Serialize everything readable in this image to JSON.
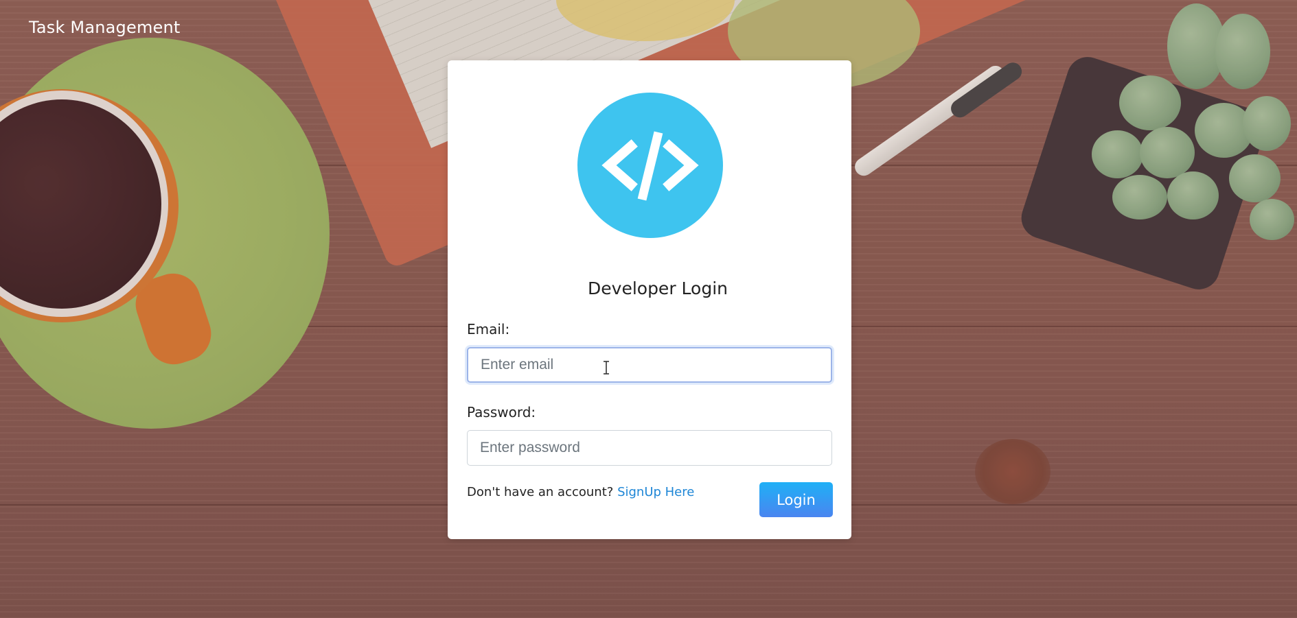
{
  "app": {
    "title": "Task Management"
  },
  "login_card": {
    "logo_icon": "code-brackets-icon",
    "title": "Developer Login",
    "email": {
      "label": "Email:",
      "placeholder": "Enter email",
      "value": ""
    },
    "password": {
      "label": "Password:",
      "placeholder": "Enter password",
      "value": ""
    },
    "signup_prompt": "Don't have an account?",
    "signup_link": "SignUp Here",
    "login_button": "Login"
  },
  "colors": {
    "logo": "#3ec4ef",
    "link": "#1e86d6",
    "button_top": "#1fb0f6",
    "button_bottom": "#4a85f0"
  }
}
